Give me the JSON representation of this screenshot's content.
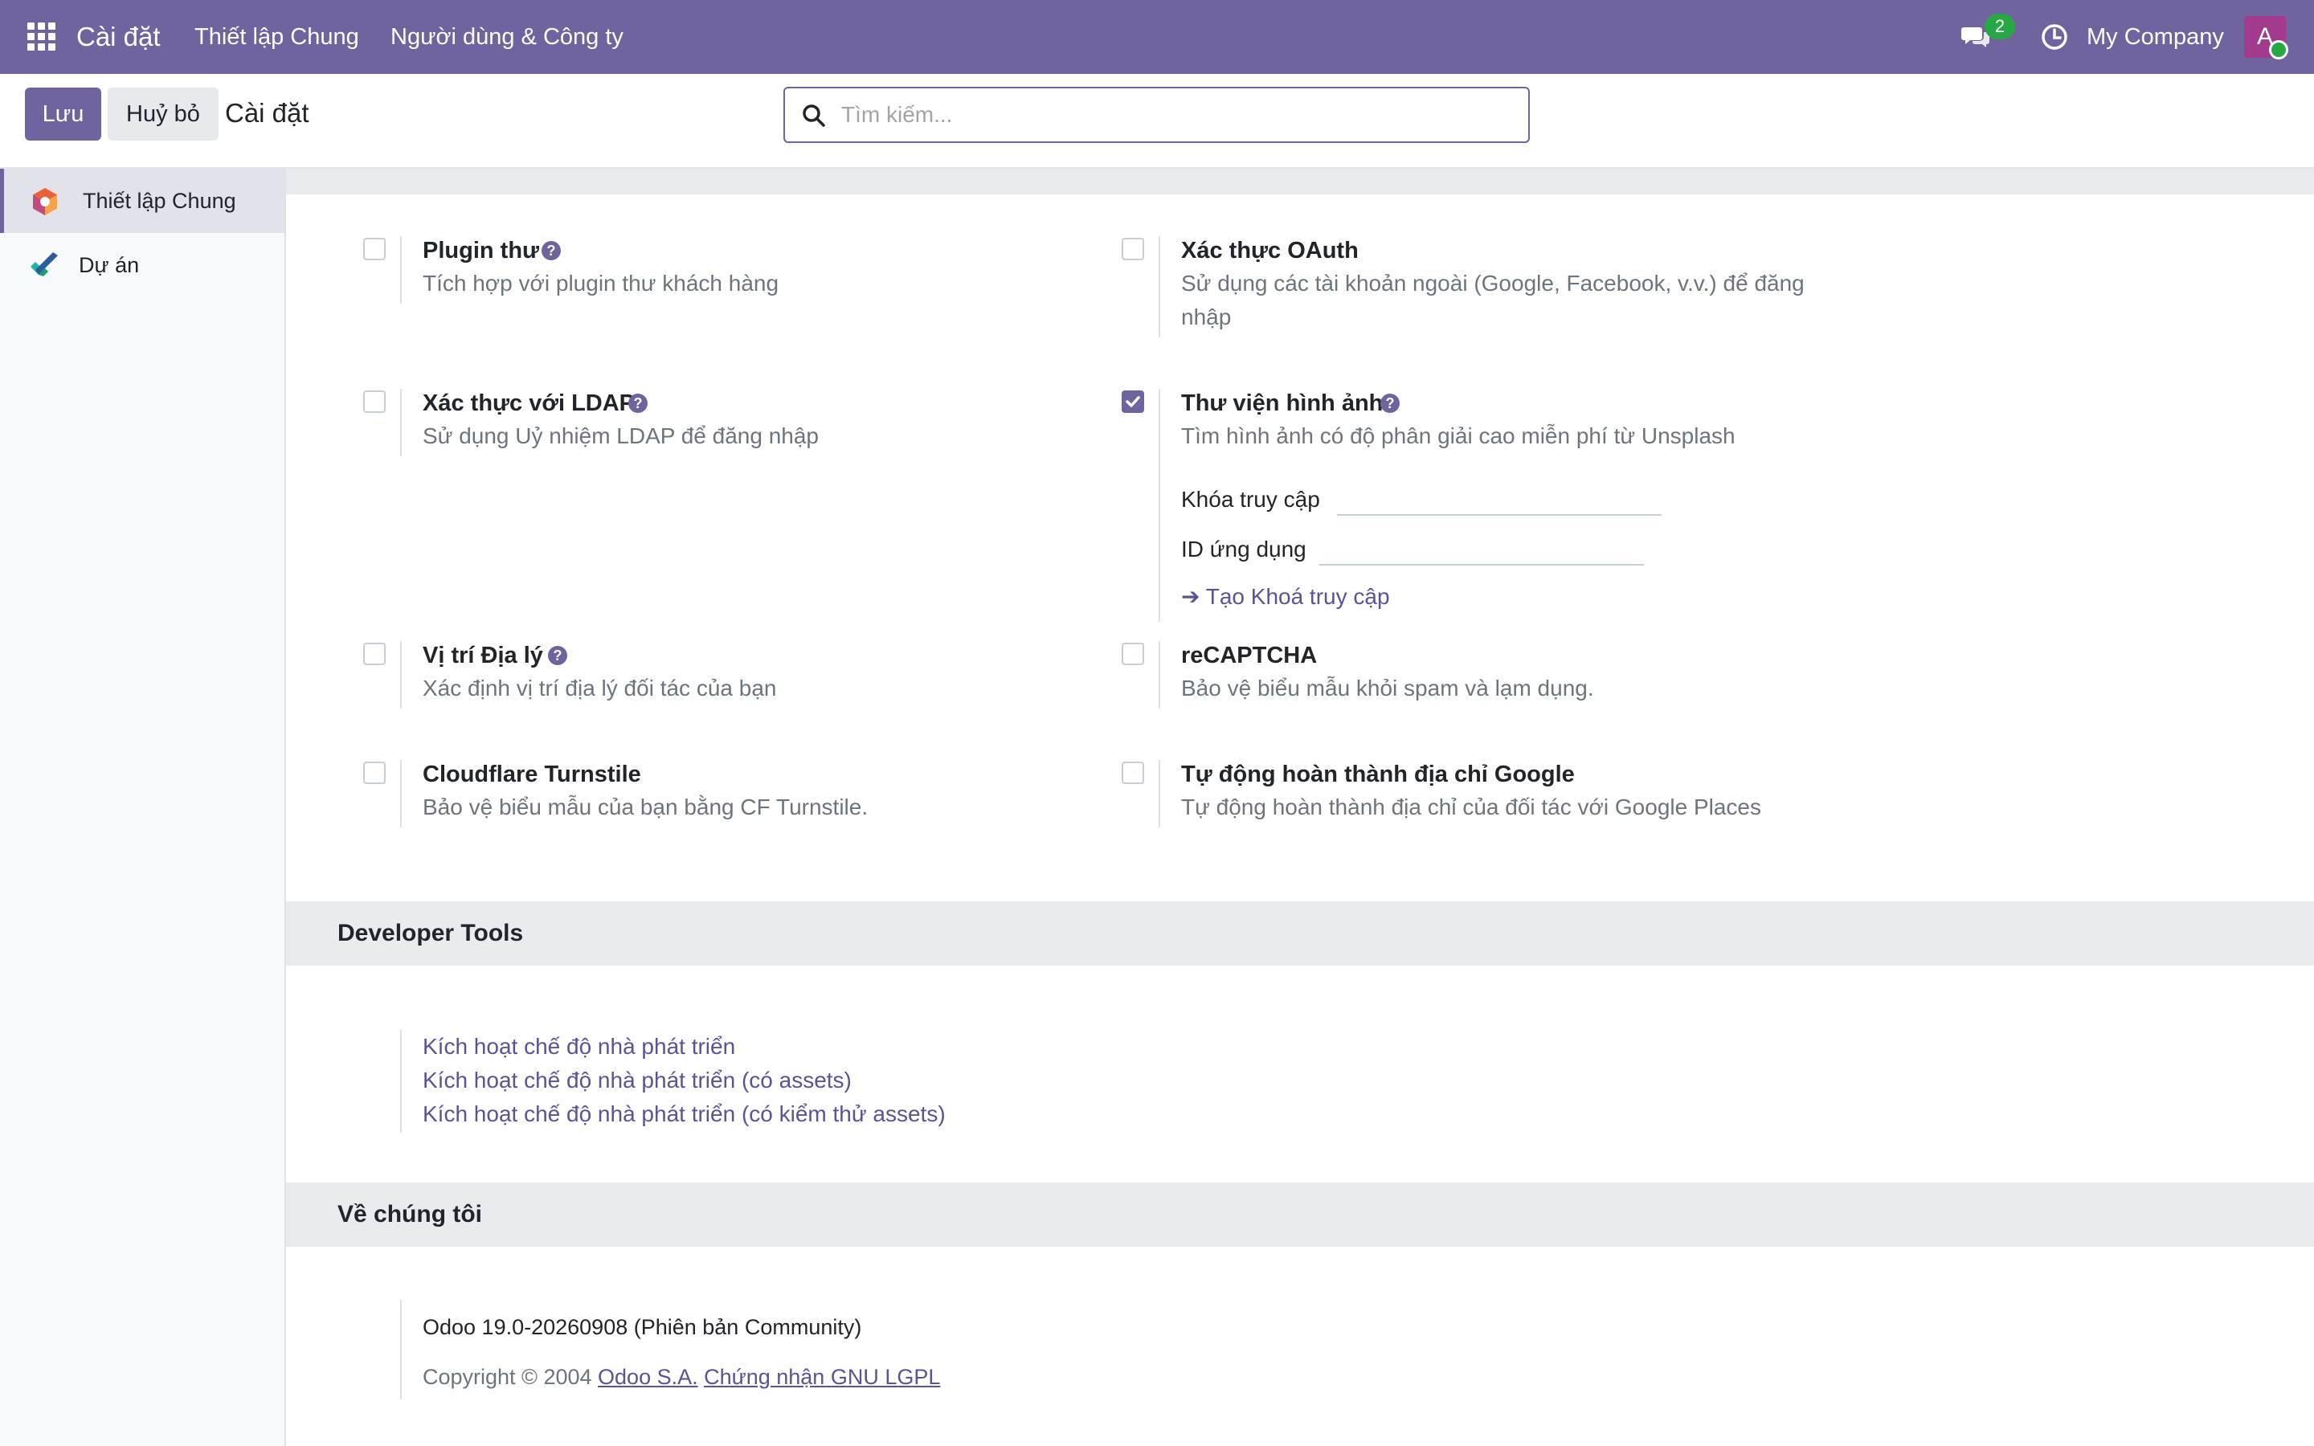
{
  "navbar": {
    "app_name": "Cài đặt",
    "menus": [
      "Thiết lập Chung",
      "Người dùng & Công ty"
    ],
    "messages_badge": "2",
    "company": "My Company",
    "avatar_letter": "A"
  },
  "control_panel": {
    "save_label": "Lưu",
    "discard_label": "Huỷ bỏ",
    "title": "Cài đặt",
    "search_placeholder": "Tìm kiếm..."
  },
  "sidebar": {
    "items": [
      {
        "label": "Thiết lập Chung",
        "active": true,
        "icon": "settings-app-icon"
      },
      {
        "label": "Dự án",
        "active": false,
        "icon": "project-app-icon"
      }
    ]
  },
  "settings": {
    "mail_plugin": {
      "title": "Plugin thư",
      "desc": "Tích hợp với plugin thư khách hàng",
      "checked": false
    },
    "oauth": {
      "title": "Xác thực OAuth",
      "desc_line1": "Sử dụng các tài khoản ngoài (Google, Facebook, v.v.) để đăng",
      "desc_line2": "nhập",
      "checked": false
    },
    "ldap": {
      "title": "Xác thực với LDAP",
      "desc": "Sử dụng Uỷ nhiệm LDAP để đăng nhập",
      "checked": false
    },
    "unsplash": {
      "title": "Thư viện hình ảnh",
      "desc": "Tìm hình ảnh có độ phân giải cao miễn phí từ Unsplash",
      "checked": true,
      "access_key_label": "Khóa truy cập",
      "app_id_label": "ID ứng dụng",
      "generate_link": "Tạo Khoá truy cập"
    },
    "geolocation": {
      "title": "Vị trí Địa lý",
      "desc": "Xác định vị trí địa lý đối tác của bạn",
      "checked": false
    },
    "recaptcha": {
      "title": "reCAPTCHA",
      "desc": "Bảo vệ biểu mẫu khỏi spam và lạm dụng.",
      "checked": false
    },
    "turnstile": {
      "title": "Cloudflare Turnstile",
      "desc": "Bảo vệ biểu mẫu của bạn bằng CF Turnstile.",
      "checked": false
    },
    "google_places": {
      "title": "Tự động hoàn thành địa chỉ Google",
      "desc": "Tự động hoàn thành địa chỉ của đối tác với Google Places",
      "checked": false
    }
  },
  "developer_tools": {
    "header": "Developer Tools",
    "links": [
      "Kích hoạt chế độ nhà phát triển",
      "Kích hoạt chế độ nhà phát triển (có assets)",
      "Kích hoạt chế độ nhà phát triển (có kiểm thử assets)"
    ]
  },
  "about": {
    "header": "Về chúng tôi",
    "version": "Odoo 19.0-20260908 (Phiên bản Community)",
    "copyright_prefix": "Copyright © 2004",
    "company_link": "Odoo S.A.",
    "license_link": "Chứng nhận GNU LGPL"
  },
  "colors": {
    "brand": "#71639e",
    "badge": "#28a745",
    "avatar": "#a23b8e"
  }
}
